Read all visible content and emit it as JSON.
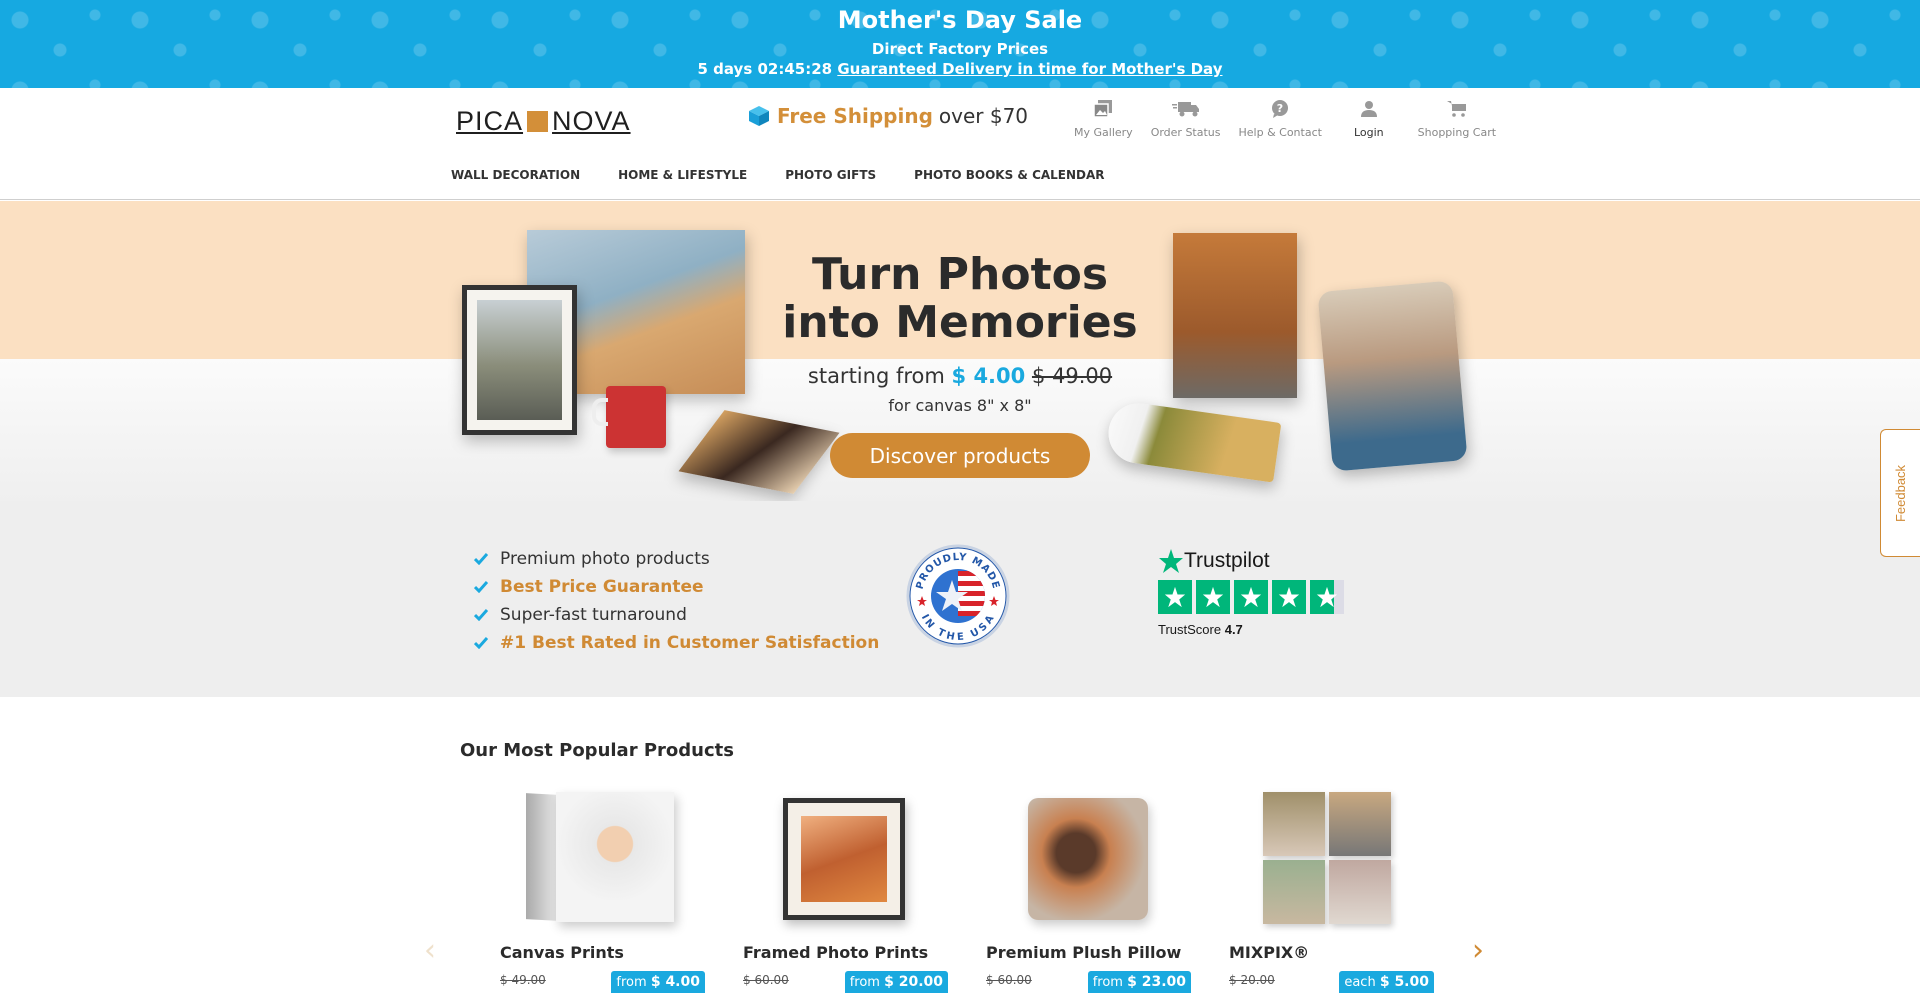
{
  "promo": {
    "title": "Mother's Day Sale",
    "subtitle": "Direct Factory Prices",
    "countdown": "5 days 02:45:28",
    "delivery_link": "Guaranteed Delivery in time for Mother's Day",
    "color": "#16a9e1"
  },
  "header": {
    "logo_left": "PICA",
    "logo_right": "NOVA",
    "shipping_highlight": "Free Shipping",
    "shipping_rest": "over $70",
    "utilities": [
      {
        "label": "My Gallery",
        "icon": "gallery-icon"
      },
      {
        "label": "Order Status",
        "icon": "truck-icon"
      },
      {
        "label": "Help & Contact",
        "icon": "help-icon"
      },
      {
        "label": "Login",
        "icon": "user-icon"
      },
      {
        "label": "Shopping Cart",
        "icon": "cart-icon"
      }
    ],
    "nav": [
      "WALL DECORATION",
      "HOME & LIFESTYLE",
      "PHOTO GIFTS",
      "PHOTO BOOKS & CALENDAR"
    ]
  },
  "hero": {
    "title_line1": "Turn Photos",
    "title_line2": "into Memories",
    "starting_from": "starting from",
    "price_now": "$ 4.00",
    "price_old": "$ 49.00",
    "note": "for canvas 8\" x 8\"",
    "cta": "Discover products"
  },
  "trust": {
    "usps": [
      {
        "text": "Premium photo products",
        "accent": false
      },
      {
        "text": "Best Price Guarantee",
        "accent": true
      },
      {
        "text": "Super-fast turnaround",
        "accent": false
      },
      {
        "text": "#1 Best Rated in Customer Satisfaction",
        "accent": true
      }
    ],
    "usa_badge_top": "PROUDLY MADE",
    "usa_badge_bottom": "IN THE USA",
    "trustpilot": {
      "brand": "Trustpilot",
      "score_label": "TrustScore",
      "score": "4.7",
      "stars": 4.7
    }
  },
  "popular": {
    "title": "Our Most Popular Products",
    "products": [
      {
        "name": "Canvas Prints",
        "old_price": "$ 49.00",
        "price_prefix": "from",
        "price": "$ 4.00"
      },
      {
        "name": "Framed Photo Prints",
        "old_price": "$ 60.00",
        "price_prefix": "from",
        "price": "$ 20.00"
      },
      {
        "name": "Premium Plush Pillow",
        "old_price": "$ 60.00",
        "price_prefix": "from",
        "price": "$ 23.00"
      },
      {
        "name": "MIXPIX®",
        "old_price": "$ 20.00",
        "price_prefix": "each",
        "price": "$ 5.00"
      }
    ],
    "prev": "‹",
    "next": "›"
  },
  "feedback": "Feedback",
  "colors": {
    "accent_orange": "#d08a34",
    "accent_blue": "#1aa9df",
    "trustpilot_green": "#00b67a"
  }
}
